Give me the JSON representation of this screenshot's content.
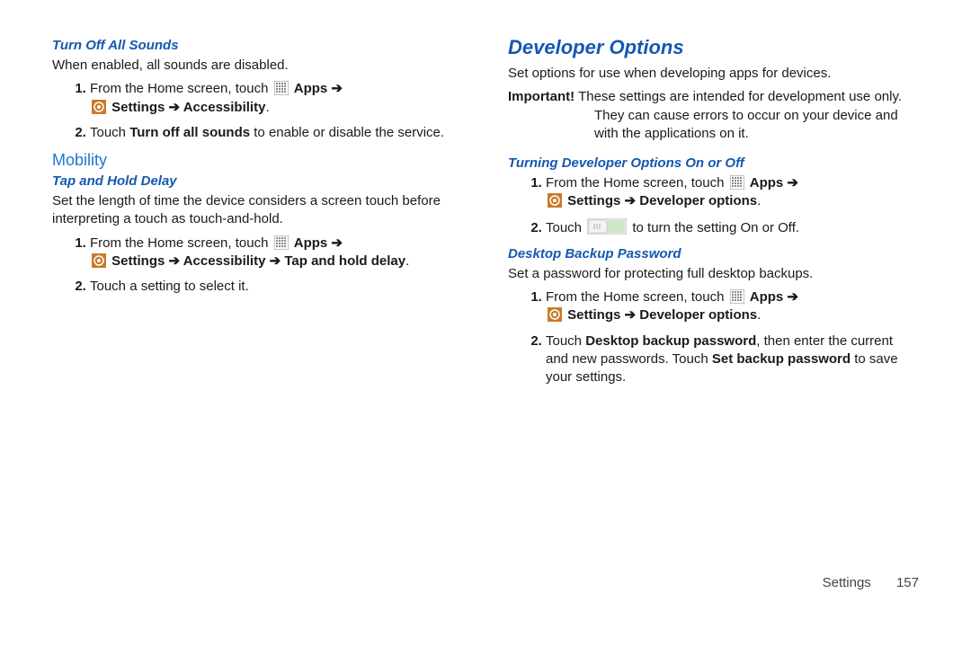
{
  "left": {
    "turnoff": {
      "heading": "Turn Off All Sounds",
      "intro": "When enabled, all sounds are disabled.",
      "step1_pre": "From the Home screen, touch ",
      "apps": "Apps",
      "arrow": " ➔ ",
      "settings": "Settings",
      "accessibility": "Accessibility",
      "step2a": "Touch ",
      "step2b": "Turn off all sounds",
      "step2c": " to enable or disable the service."
    },
    "mobility": "Mobility",
    "tap": {
      "heading": "Tap and Hold Delay",
      "intro": "Set the length of time the device considers a screen touch before interpreting a touch as touch-and-hold.",
      "step1_pre": "From the Home screen, touch ",
      "apps": "Apps",
      "arrow": " ➔ ",
      "settings": "Settings",
      "accessibility": "Accessibility",
      "taphold": "Tap and hold delay",
      "step2": "Touch a setting to select it."
    }
  },
  "right": {
    "dev": {
      "heading": "Developer Options",
      "intro": "Set options for use when developing apps for devices.",
      "important_label": "Important!",
      "important_text": " These settings are intended for development use only. They can cause errors to occur on your device and with the applications on it."
    },
    "onoff": {
      "heading": "Turning Developer Options On or Off",
      "step1_pre": "From the Home screen, touch ",
      "apps": "Apps",
      "arrow": " ➔ ",
      "settings": "Settings",
      "devopt": "Developer options",
      "step2a": "Touch ",
      "step2b": " to turn the setting On or Off."
    },
    "backup": {
      "heading": "Desktop Backup Password",
      "intro": "Set a password for protecting full desktop backups.",
      "step1_pre": "From the Home screen, touch ",
      "apps": "Apps",
      "arrow": " ➔ ",
      "settings": "Settings",
      "devopt": "Developer options",
      "step2a": "Touch ",
      "step2b": "Desktop backup password",
      "step2c": ", then enter the current and new passwords. Touch ",
      "step2d": "Set backup password",
      "step2e": " to save your settings."
    }
  },
  "footer": {
    "label": "Settings",
    "page": "157"
  }
}
